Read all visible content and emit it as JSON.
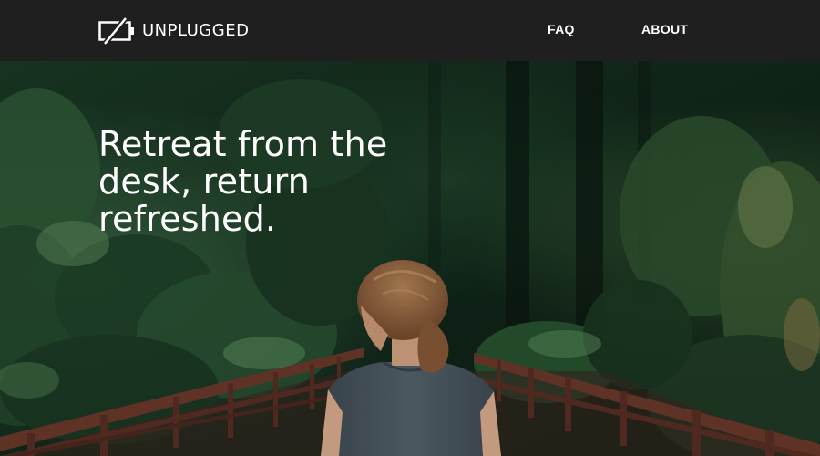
{
  "brand": {
    "name": "UNPLUGGED",
    "logo_icon": "unplugged-battery-icon"
  },
  "nav": {
    "items": [
      {
        "label": "FAQ"
      },
      {
        "label": "ABOUT"
      }
    ]
  },
  "hero": {
    "headline": "Retreat from the desk, return refreshed.",
    "image": "woman-on-forest-bridge-photo"
  },
  "colors": {
    "nav_background": "#1f1f1f",
    "text": "#ffffff",
    "forest_dark": "#0f2418",
    "forest_mid": "#2b5535",
    "bridge_wood": "#6d3a2c",
    "shirt": "#4f5d66",
    "hair": "#9a6a45"
  }
}
